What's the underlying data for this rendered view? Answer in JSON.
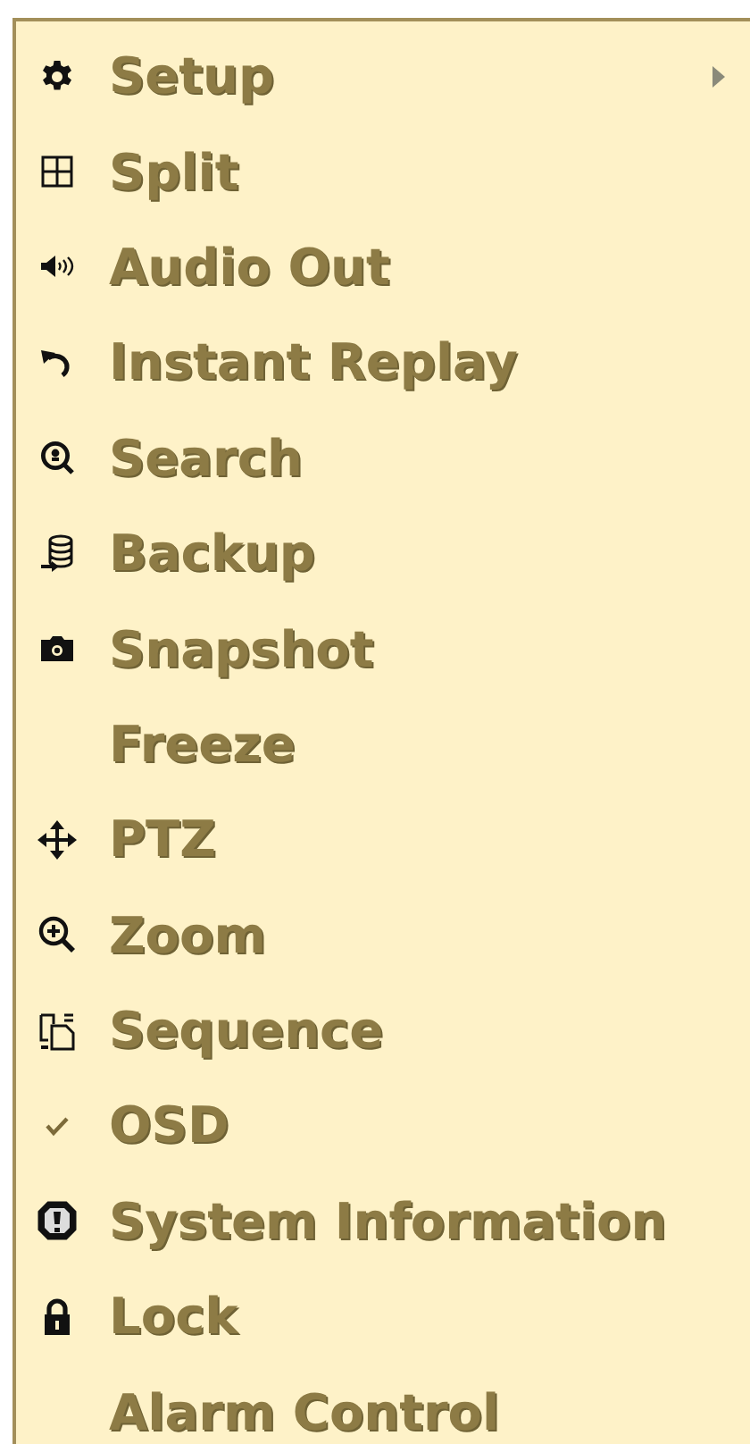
{
  "menu": {
    "items": [
      {
        "label": "Setup",
        "kind": "icon",
        "submenu": true
      },
      {
        "label": "Split",
        "kind": "icon"
      },
      {
        "label": "Audio Out",
        "kind": "icon"
      },
      {
        "label": "Instant Replay",
        "kind": "icon"
      },
      {
        "label": "Search",
        "kind": "icon"
      },
      {
        "label": "Backup",
        "kind": "icon"
      },
      {
        "label": "Snapshot",
        "kind": "icon"
      },
      {
        "label": "Freeze",
        "kind": "plain"
      },
      {
        "label": "PTZ",
        "kind": "icon"
      },
      {
        "label": "Zoom",
        "kind": "icon"
      },
      {
        "label": "Sequence",
        "kind": "icon"
      },
      {
        "label": "OSD",
        "kind": "check",
        "checked": true
      },
      {
        "label": "System Information",
        "kind": "icon"
      },
      {
        "label": "Lock",
        "kind": "icon"
      },
      {
        "label": "Alarm Control",
        "kind": "plain"
      }
    ]
  }
}
